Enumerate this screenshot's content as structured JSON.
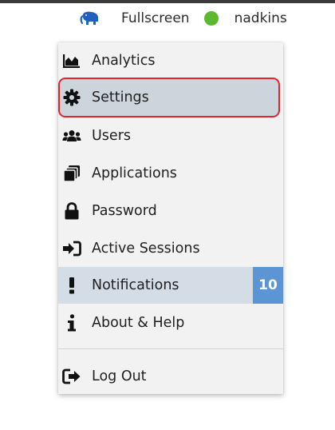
{
  "header": {
    "fullscreen_label": "Fullscreen",
    "username": "nadkins",
    "status_color": "#5cb82f",
    "logo_icon": "elephant-icon"
  },
  "menu": {
    "items": [
      {
        "label": "Analytics",
        "icon": "analytics-icon"
      },
      {
        "label": "Settings",
        "icon": "gear-icon",
        "highlighted": true
      },
      {
        "label": "Users",
        "icon": "users-icon"
      },
      {
        "label": "Applications",
        "icon": "applications-icon"
      },
      {
        "label": "Password",
        "icon": "lock-icon"
      },
      {
        "label": "Active Sessions",
        "icon": "sign-in-icon"
      },
      {
        "label": "Notifications",
        "icon": "exclamation-icon",
        "badge": "10",
        "active": true
      },
      {
        "label": "About & Help",
        "icon": "info-icon"
      },
      {
        "label": "Log Out",
        "icon": "sign-out-icon"
      }
    ]
  },
  "colors": {
    "highlight_border": "#e0262d",
    "badge_bg": "#5b95d4",
    "active_row_bg": "#d4dde6",
    "brand_icon": "#1f5fbf"
  }
}
